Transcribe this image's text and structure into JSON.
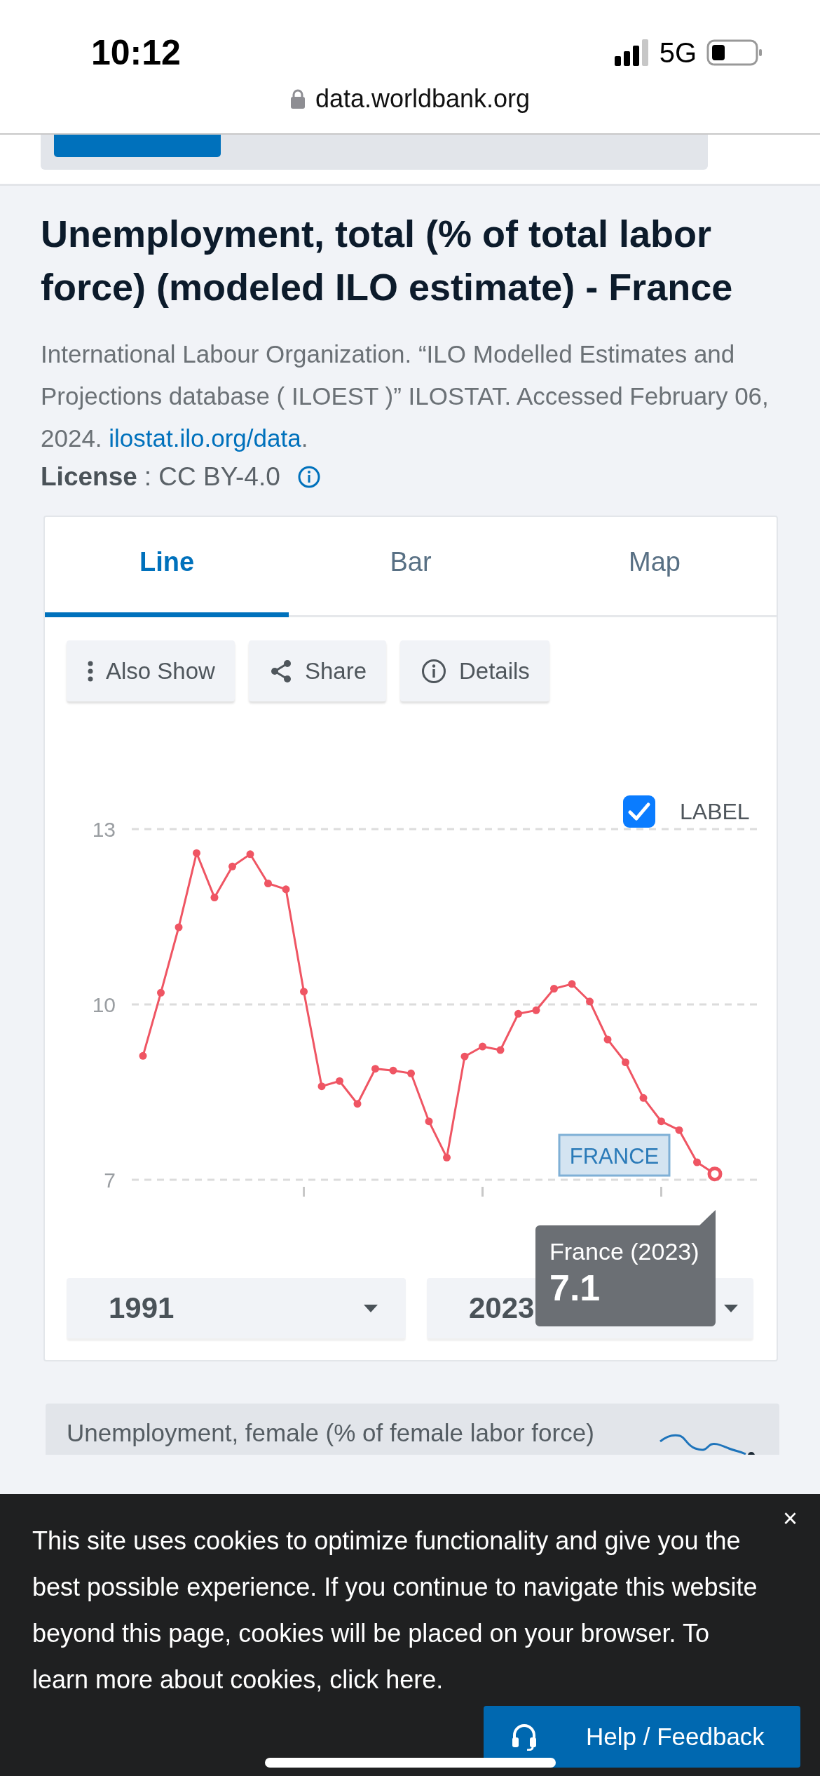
{
  "status_bar": {
    "time": "10:12",
    "network": "5G"
  },
  "address_bar": {
    "url": "data.worldbank.org"
  },
  "title": "Unemployment, total (% of total labor force) (modeled ILO estimate) - France",
  "source": {
    "text": "International Labour Organization. “ILO Modelled Estimates and Projections database ( ILOEST )” ILOSTAT. Accessed February 06, 2024. ",
    "link": "ilostat.ilo.org/data",
    "end": "."
  },
  "license": {
    "label": "License",
    "value": ": CC BY-4.0"
  },
  "tabs": [
    {
      "label": "Line",
      "selected": true
    },
    {
      "label": "Bar",
      "selected": false
    },
    {
      "label": "Map",
      "selected": false
    }
  ],
  "toolbar": [
    {
      "kind": "more",
      "label": "Also Show"
    },
    {
      "kind": "share",
      "label": "Share"
    },
    {
      "kind": "info",
      "label": "Details"
    }
  ],
  "label_toggle": {
    "label": "LABEL",
    "checked": true
  },
  "chart_data": {
    "type": "line",
    "ylim": [
      7,
      13
    ],
    "yticks": [
      7,
      10,
      13
    ],
    "series": [
      {
        "name": "FRANCE",
        "color": "#ef5563",
        "marker": "circle",
        "values": [
          9.12,
          10.2,
          11.32,
          12.59,
          11.83,
          12.36,
          12.57,
          12.07,
          11.97,
          10.22,
          8.6,
          8.69,
          8.3,
          8.9,
          8.87,
          8.82,
          8.0,
          7.38,
          9.11,
          9.28,
          9.22,
          9.84,
          9.9,
          10.27,
          10.35,
          10.05,
          9.4,
          9.01,
          8.4,
          8.0,
          7.85,
          7.3,
          7.1
        ]
      }
    ]
  },
  "tooltip": {
    "title": "France (2023)",
    "value": "7.1"
  },
  "range": {
    "start": "1991",
    "end": "2023"
  },
  "related": [
    {
      "title": "Unemployment, female (% of female labor force)"
    }
  ],
  "cookie_banner": {
    "text": "This site uses cookies to optimize functionality and give you the best possible experience. If you continue to navigate this website beyond this page, cookies will be placed on your browser. To learn more about cookies, click here.",
    "close": "×"
  },
  "help_button": {
    "label": "Help / Feedback"
  }
}
